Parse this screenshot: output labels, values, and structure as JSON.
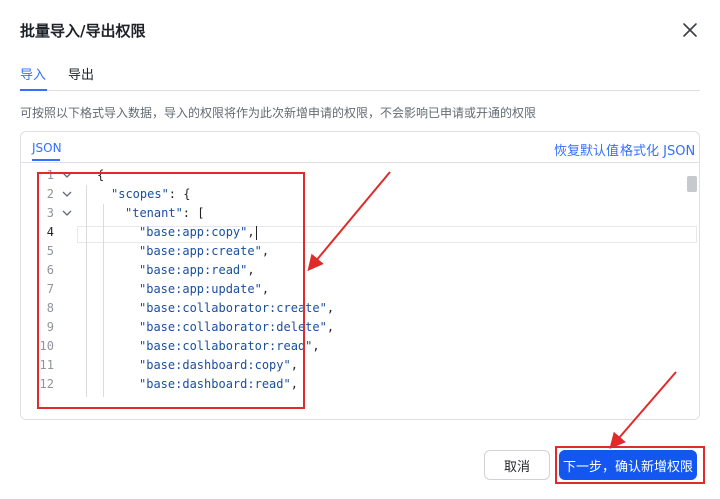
{
  "dialog": {
    "title": "批量导入/导出权限",
    "tabs": [
      {
        "label": "导入",
        "active": true
      },
      {
        "label": "导出",
        "active": false
      }
    ],
    "description": "可按照以下格式导入数据，导入的权限将作为此次新增申请的权限，不会影响已申请或开通的权限"
  },
  "panel": {
    "tab_label": "JSON",
    "reset_link": "恢复默认值",
    "format_link": "格式化 JSON"
  },
  "editor": {
    "lines": [
      {
        "n": "1",
        "text": "{"
      },
      {
        "n": "2",
        "text": "\"scopes\": {"
      },
      {
        "n": "3",
        "text": "\"tenant\": ["
      },
      {
        "n": "4",
        "text": "\"base:app:copy\","
      },
      {
        "n": "5",
        "text": "\"base:app:create\","
      },
      {
        "n": "6",
        "text": "\"base:app:read\","
      },
      {
        "n": "7",
        "text": "\"base:app:update\","
      },
      {
        "n": "8",
        "text": "\"base:collaborator:create\","
      },
      {
        "n": "9",
        "text": "\"base:collaborator:delete\","
      },
      {
        "n": "10",
        "text": "\"base:collaborator:read\","
      },
      {
        "n": "11",
        "text": "\"base:dashboard:copy\","
      },
      {
        "n": "12",
        "text": "\"base:dashboard:read\","
      }
    ],
    "active_line": 4
  },
  "footer": {
    "cancel_label": "取消",
    "confirm_label": "下一步，确认新增权限"
  },
  "colors": {
    "accent": "#3370ff",
    "primary_button": "#1456f0",
    "annotation": "#e02b2b",
    "string": "#1b4fa0"
  }
}
